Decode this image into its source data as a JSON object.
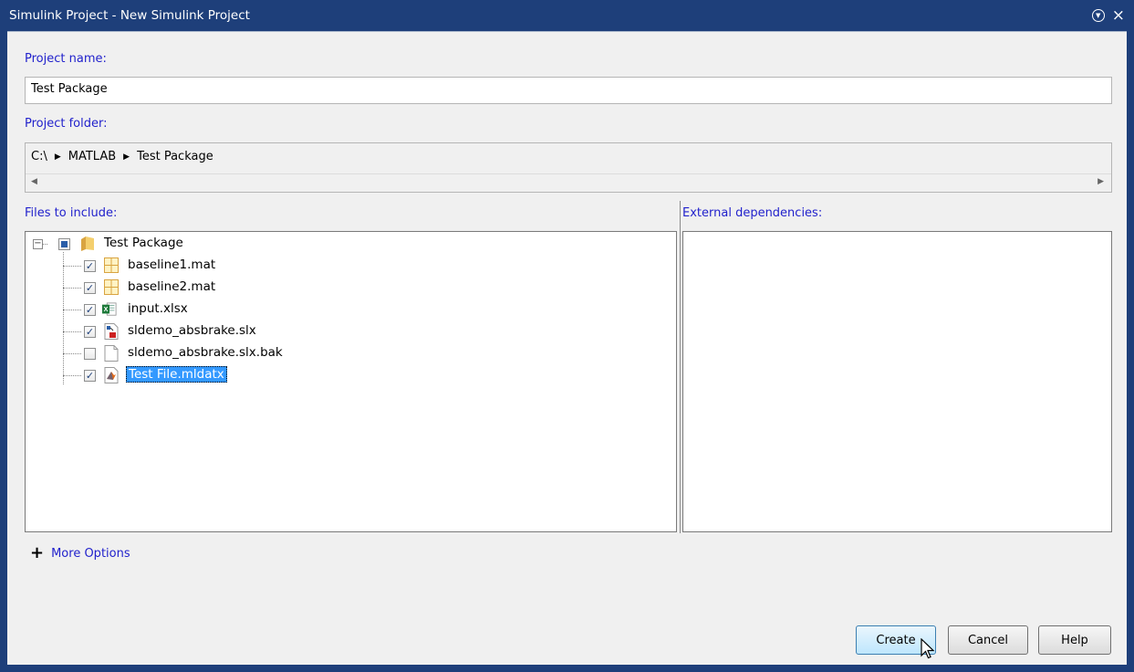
{
  "window": {
    "title": "Simulink Project - New Simulink Project"
  },
  "project_name": {
    "label": "Project name:",
    "value": "Test Package"
  },
  "project_folder": {
    "label": "Project folder:",
    "path": [
      "C:\\",
      "MATLAB",
      "Test Package"
    ]
  },
  "files": {
    "label": "Files to include:",
    "root": "Test Package",
    "items": [
      {
        "name": "baseline1.mat",
        "checked": true,
        "icon": "mat-grid-icon"
      },
      {
        "name": "baseline2.mat",
        "checked": true,
        "icon": "mat-grid-icon"
      },
      {
        "name": "input.xlsx",
        "checked": true,
        "icon": "excel-icon"
      },
      {
        "name": "sldemo_absbrake.slx",
        "checked": true,
        "icon": "simulink-model-icon"
      },
      {
        "name": "sldemo_absbrake.slx.bak",
        "checked": false,
        "icon": "blank-file-icon"
      },
      {
        "name": "Test File.mldatx",
        "checked": true,
        "icon": "matlab-data-icon",
        "selected": true
      }
    ]
  },
  "external": {
    "label": "External dependencies:"
  },
  "more_options": {
    "label": "More Options"
  },
  "buttons": {
    "create": "Create",
    "cancel": "Cancel",
    "help": "Help"
  },
  "colors": {
    "title_bar": "#1e3f7a",
    "label_blue": "#2222cc",
    "selection": "#3399ff"
  }
}
